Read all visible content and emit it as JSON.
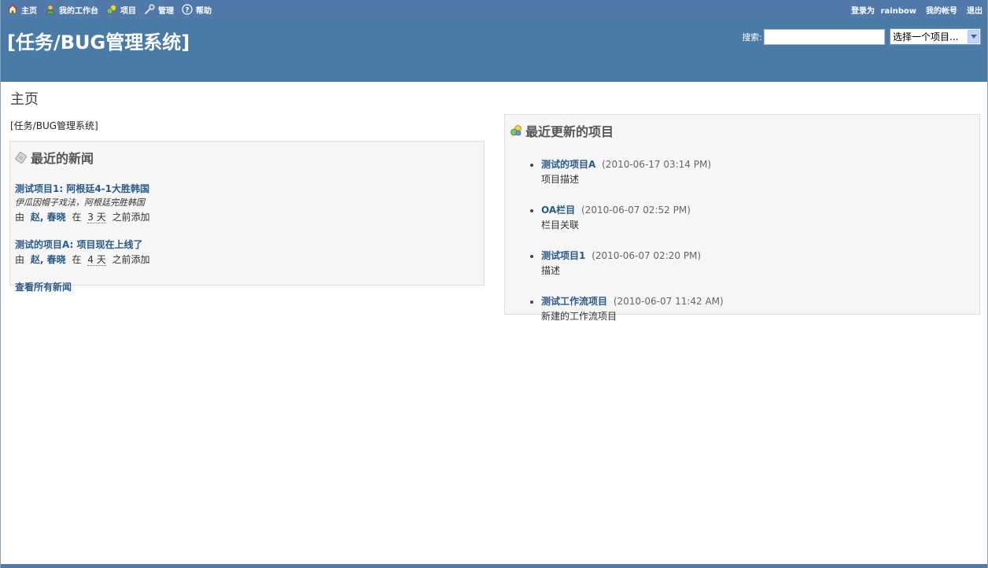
{
  "top_menu": {
    "items": [
      {
        "label": "主页",
        "icon": "home-icon"
      },
      {
        "label": "我的工作台",
        "icon": "user-icon"
      },
      {
        "label": "项目",
        "icon": "projects-icon"
      },
      {
        "label": "管理",
        "icon": "wrench-icon"
      },
      {
        "label": "帮助",
        "icon": "help-icon"
      }
    ],
    "logged_in_prefix": "登录为",
    "username": "rainbow",
    "my_account": "我的帐号",
    "logout": "退出"
  },
  "header": {
    "title": "[任务/BUG管理系统]",
    "search_label": "搜索:",
    "search_value": "",
    "project_select": "选择一个项目..."
  },
  "page": {
    "title": "主页",
    "welcome": "[任务/BUG管理系统]"
  },
  "news": {
    "heading": "最近的新闻",
    "items": [
      {
        "title": "测试项目1: 阿根廷4-1大胜韩国",
        "summary": "伊瓜因帽子戏法，阿根廷完胜韩国",
        "by": "由",
        "author": "赵, 春晓",
        "at": "在",
        "ago": "3 天",
        "suffix": "之前添加"
      },
      {
        "title": "测试的项目A: 项目现在上线了",
        "by": "由",
        "author": "赵, 春晓",
        "at": "在",
        "ago": "4 天",
        "suffix": "之前添加"
      }
    ],
    "view_all": "查看所有新闻"
  },
  "projects": {
    "heading": "最近更新的项目",
    "items": [
      {
        "name": "测试的项目A",
        "date": "(2010-06-17 03:14 PM)",
        "desc": "项目描述"
      },
      {
        "name": "OA栏目",
        "date": "(2010-06-07 02:52 PM)",
        "desc": "栏目关联"
      },
      {
        "name": "测试项目1",
        "date": "(2010-06-07 02:20 PM)",
        "desc": "描述"
      },
      {
        "name": "测试工作流项目",
        "date": "(2010-06-07 11:42 AM)",
        "desc": "新建的工作流项目"
      }
    ]
  },
  "colors": {
    "top_menu_bg": "#507aaa",
    "header_bg": "#4a7ba6",
    "link": "#2a5a8a",
    "box_bg": "#f6f6f6"
  }
}
